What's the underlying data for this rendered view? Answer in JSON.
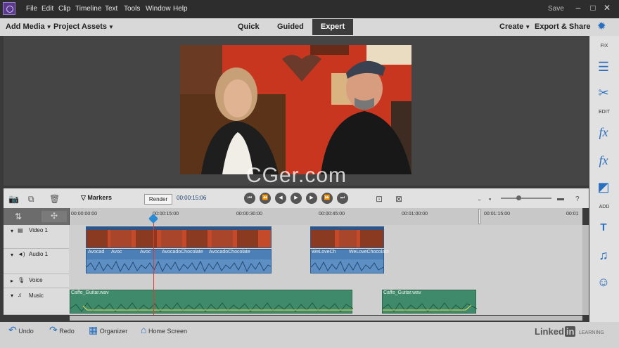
{
  "menu": {
    "items": [
      "File",
      "Edit",
      "Clip",
      "Timeline",
      "Text",
      "Tools",
      "Window",
      "Help"
    ],
    "save": "Save"
  },
  "modebar": {
    "add_media": "Add Media",
    "project_assets": "Project Assets",
    "tabs": [
      "Quick",
      "Guided",
      "Expert"
    ],
    "active_tab": "Expert",
    "create": "Create",
    "export_share": "Export & Share"
  },
  "right_panel": {
    "sections": [
      "FIX",
      "EDIT",
      "ADD"
    ]
  },
  "timeline_toolbar": {
    "markers": "Markers",
    "render": "Render",
    "timecode": "00:00:15:06"
  },
  "ruler": {
    "ticks": [
      "00:00:00:00",
      "00:00:15:00",
      "00:00:30:00",
      "00:00:45:00",
      "00:01:00:00",
      "00:01:15:00",
      "00:01"
    ]
  },
  "tracks": [
    {
      "name": "Video 1"
    },
    {
      "name": "Audio 1"
    },
    {
      "name": "Voice"
    },
    {
      "name": "Music"
    }
  ],
  "clips": {
    "audio_label": "AvocadoChocolate",
    "audio_short": "Avoc",
    "audio_short2": "Avocad",
    "audio_label2": "WeLoveChocolate",
    "audio_short3": "WeLoveCh",
    "music_label": "Caffe_Guitar.wav"
  },
  "bottom_bar": {
    "undo": "Undo",
    "redo": "Redo",
    "organizer": "Organizer",
    "home_screen": "Home Screen"
  },
  "branding": {
    "linkedin": "Linked",
    "linkedin_in": "in",
    "learning": "LEARNING",
    "watermark": "CGer.com"
  },
  "colors": {
    "accent": "#2a6fbf",
    "playhead": "#e23a2a",
    "music_clip": "#3f8a6a",
    "video_clip": "#3b6fa8"
  }
}
